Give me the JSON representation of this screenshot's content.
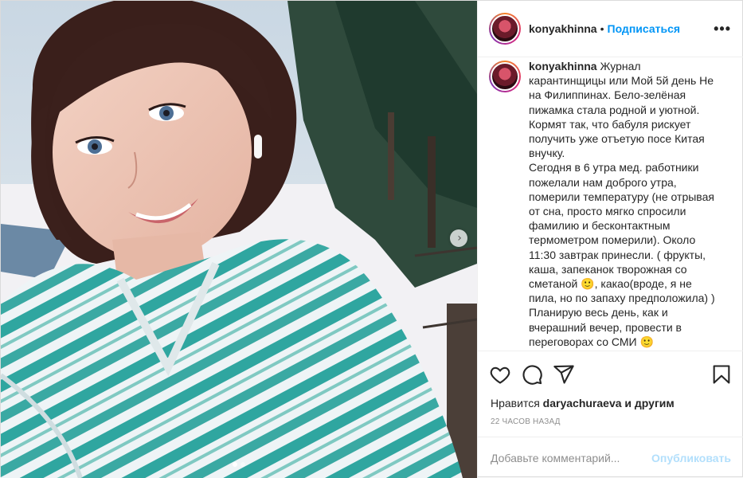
{
  "post": {
    "username": "konyakhinna",
    "separator": "•",
    "follow_label": "Подписаться",
    "more_label": "•••",
    "next_arrow": "›",
    "caption_text": "Журнал карантинщицы или Мой 5й день Не на Филиппинах. Бело-зелёная пижамка стала родной и уютной.\nКормят так, что бабуля рискует получить уже отъетую посе Китая внучку.\nСегодня в 6 утра мед. работники пожелали нам доброго утра, померили температуру (не отрывая от сна, просто мягко спросили фамилию и бесконтактным термометром померили). Около 11:30 завтрак принесли. ( фрукты, каша, запеканок творожная со сметаной 🙂, какао(вроде, я не пила, но по запаху предположила) )\nПланирую весь день, как и вчерашний вечер, провести в переговорах со СМИ 🙂",
    "likes_prefix": "Нравится",
    "likes_user": "daryachuraeva",
    "likes_suffix": "и другим",
    "timestamp": "22 ЧАСОВ НАЗАД",
    "comment_placeholder": "Добавьте комментарий...",
    "publish_label": "Опубликовать"
  },
  "icons": [
    "heart-icon",
    "comment-icon",
    "share-icon",
    "bookmark-icon",
    "more-icon",
    "chevron-right-icon"
  ],
  "colors": {
    "link_blue": "#0095f6",
    "publish_disabled": "#b2dffc",
    "meta_gray": "#8e8e8e",
    "pajama_teal": "#2fa6a0"
  }
}
